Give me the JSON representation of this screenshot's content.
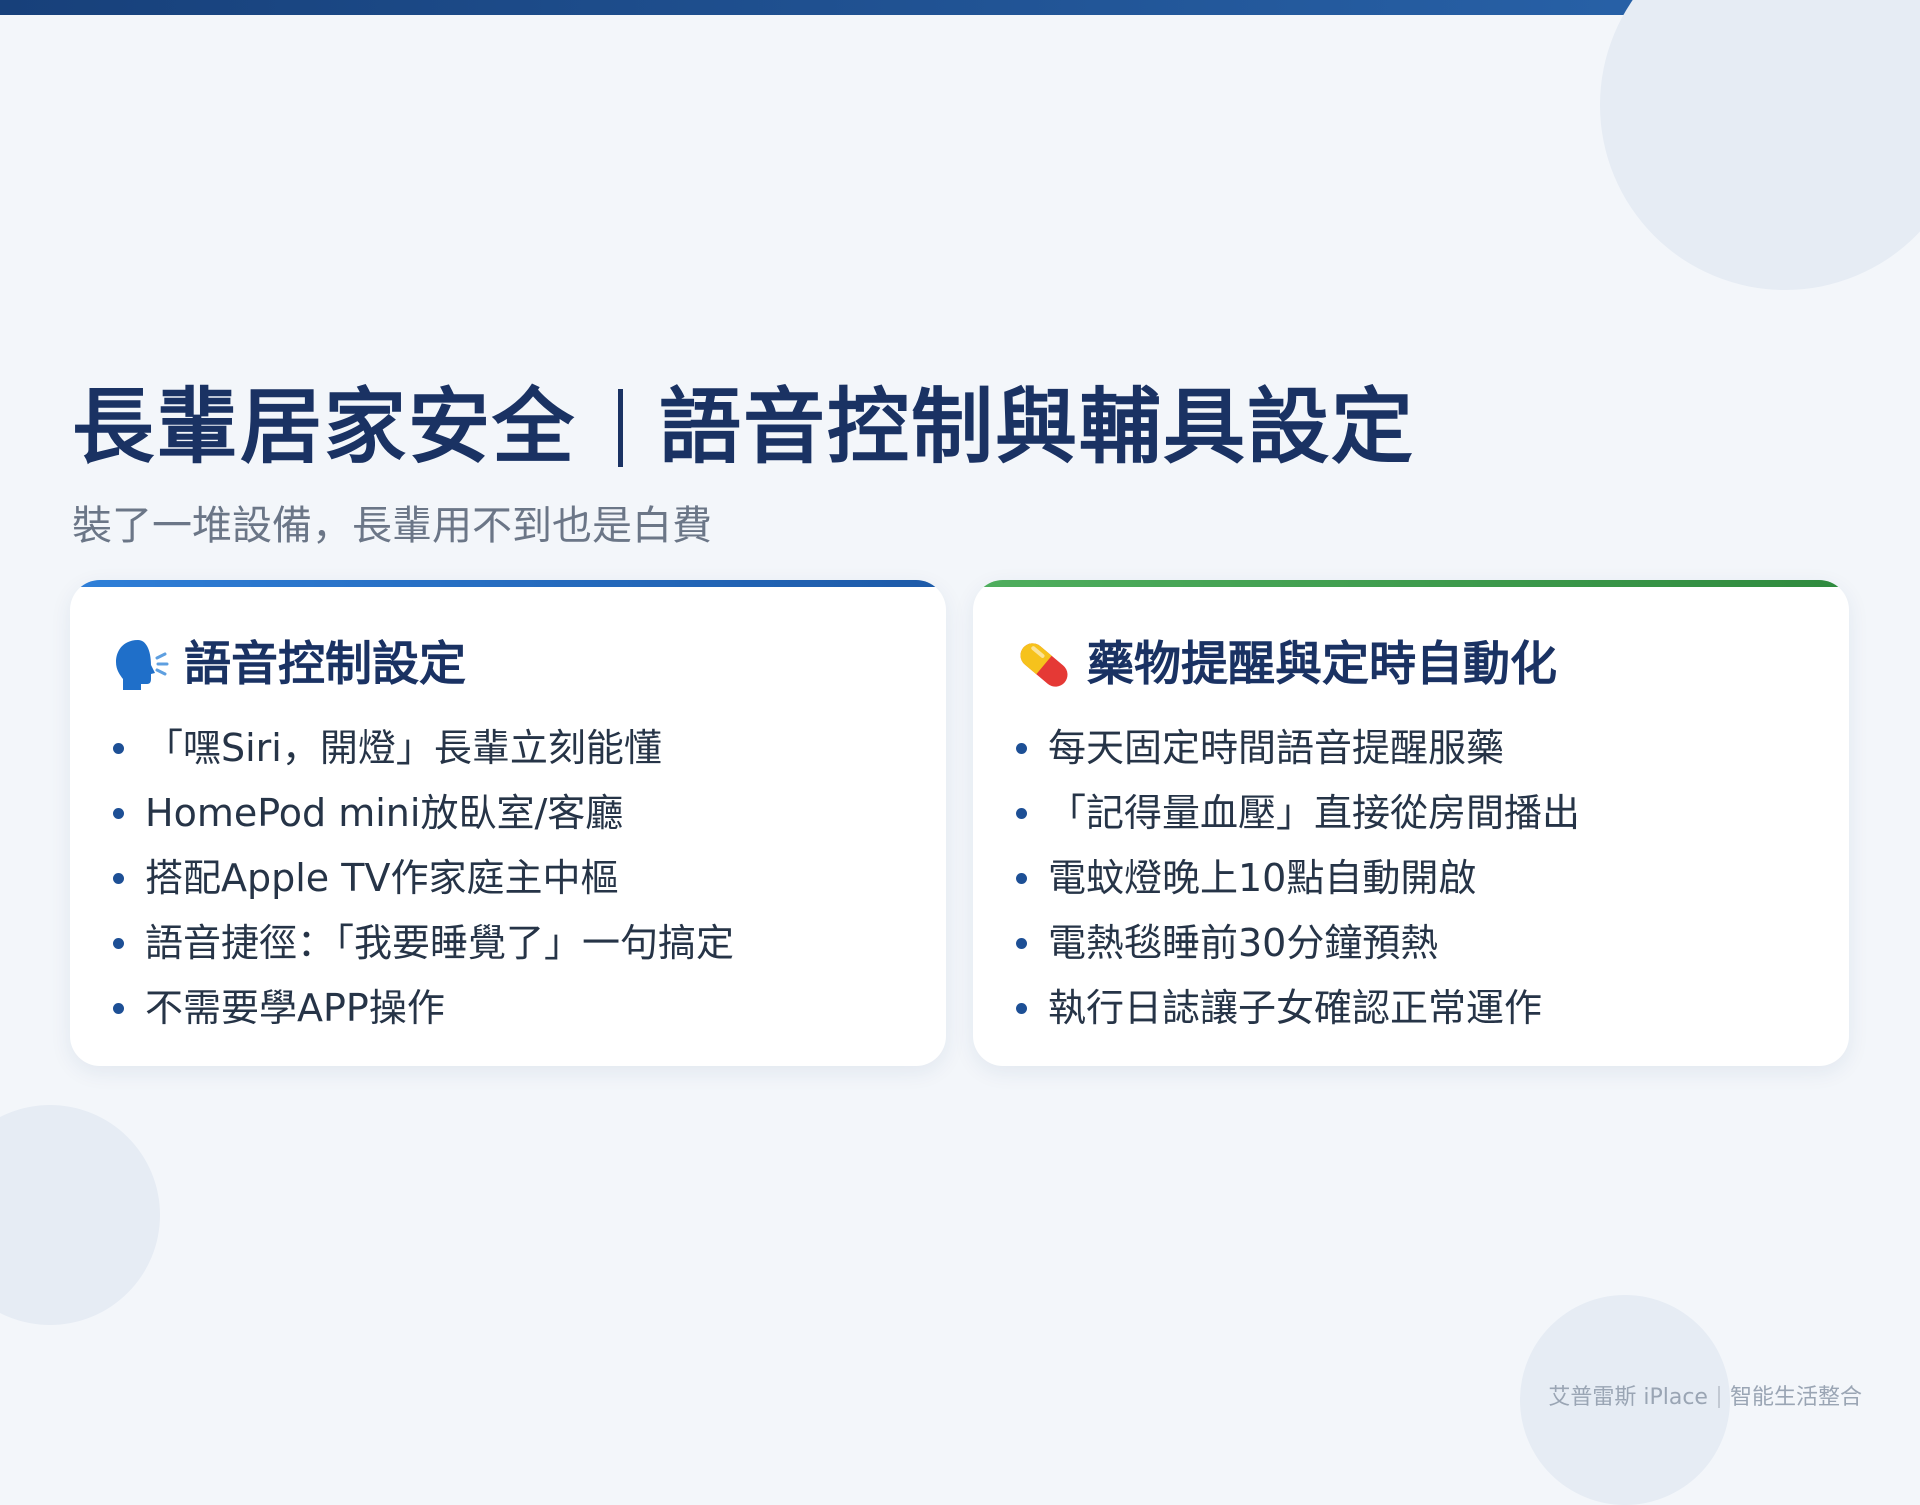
{
  "title": {
    "left": "長輩居家安全",
    "right": "語音控制與輔具設定"
  },
  "subtitle": "裝了一堆設備，長輩用不到也是白費",
  "cards": [
    {
      "icon": "speaking-head-icon",
      "accent_color": "#2f7fd8",
      "title": "語音控制設定",
      "items": [
        "「嘿Siri，開燈」長輩立刻能懂",
        "HomePod mini放臥室/客廳",
        "搭配Apple TV作家庭主中樞",
        "語音捷徑：「我要睡覺了」一句搞定",
        "不需要學APP操作"
      ]
    },
    {
      "icon": "pill-icon",
      "accent_color": "#4fae5e",
      "title": "藥物提醒與定時自動化",
      "items": [
        "每天固定時間語音提醒服藥",
        "「記得量血壓」直接從房間播出",
        "電蚊燈晚上10點自動開啟",
        "電熱毯睡前30分鐘預熱",
        "執行日誌讓子女確認正常運作"
      ]
    }
  ],
  "footer": {
    "brand": "艾普雷斯 iPlace",
    "tagline": "智能生活整合"
  }
}
